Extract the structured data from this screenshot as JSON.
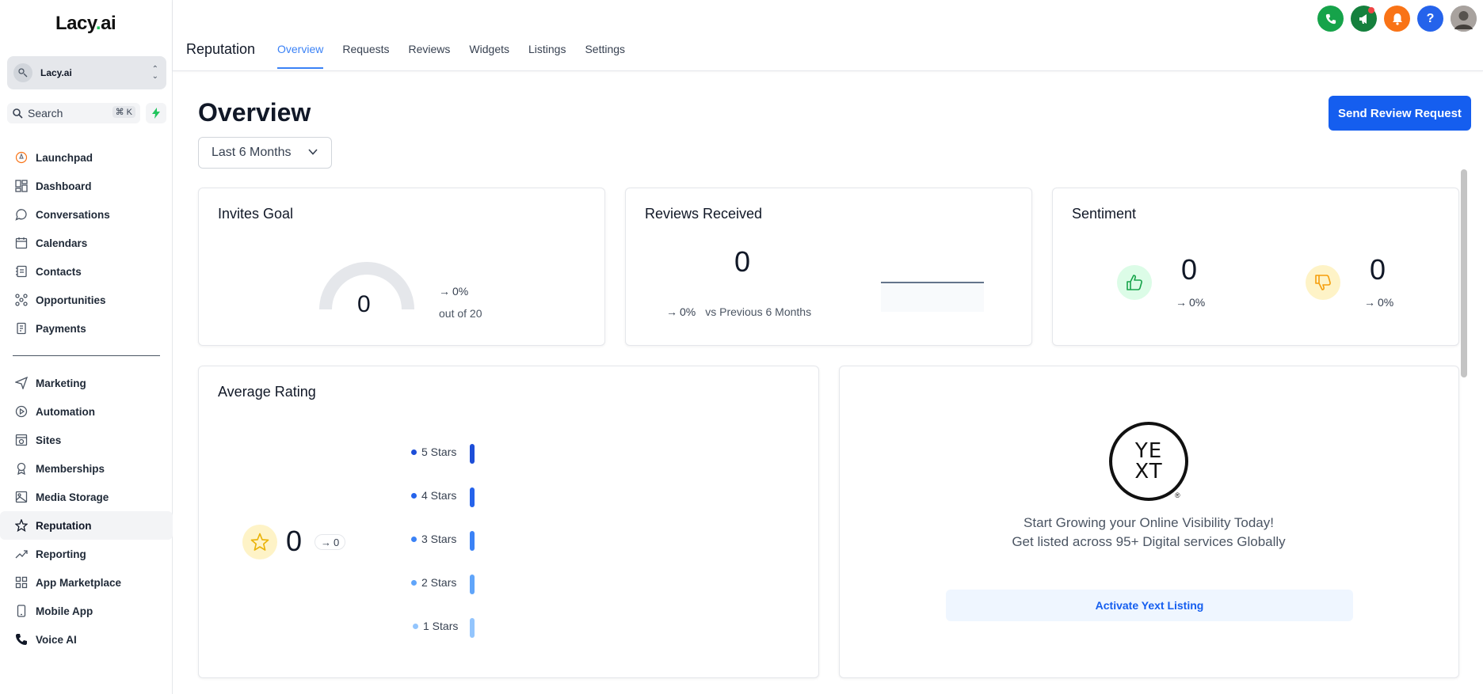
{
  "app": {
    "logo_main": "Lacy",
    "logo_dot": ".",
    "logo_tail": "ai"
  },
  "account": {
    "name": "Lacy.ai"
  },
  "search": {
    "placeholder": "Search",
    "shortcut": "⌘ K"
  },
  "sidebar": {
    "items": [
      {
        "label": "Launchpad",
        "icon": "rocket-icon"
      },
      {
        "label": "Dashboard",
        "icon": "grid-icon"
      },
      {
        "label": "Conversations",
        "icon": "chat-icon"
      },
      {
        "label": "Calendars",
        "icon": "calendar-icon"
      },
      {
        "label": "Contacts",
        "icon": "contacts-icon"
      },
      {
        "label": "Opportunities",
        "icon": "opportunities-icon"
      },
      {
        "label": "Payments",
        "icon": "payments-icon"
      }
    ],
    "items2": [
      {
        "label": "Marketing",
        "icon": "send-icon"
      },
      {
        "label": "Automation",
        "icon": "automation-icon"
      },
      {
        "label": "Sites",
        "icon": "sites-icon"
      },
      {
        "label": "Memberships",
        "icon": "award-icon"
      },
      {
        "label": "Media Storage",
        "icon": "image-icon"
      },
      {
        "label": "Reputation",
        "icon": "star-icon",
        "active": true
      },
      {
        "label": "Reporting",
        "icon": "trend-icon"
      },
      {
        "label": "App Marketplace",
        "icon": "apps-icon"
      },
      {
        "label": "Mobile App",
        "icon": "mobile-icon"
      },
      {
        "label": "Voice AI",
        "icon": "phone-icon"
      }
    ]
  },
  "header": {
    "section": "Reputation",
    "tabs": [
      "Overview",
      "Requests",
      "Reviews",
      "Widgets",
      "Listings",
      "Settings"
    ],
    "active_tab": "Overview",
    "icon_colors": {
      "phone": "#16a34a",
      "announce": "#15803d",
      "bell": "#f97316",
      "help": "#2563eb"
    }
  },
  "main": {
    "title": "Overview",
    "range": "Last 6 Months",
    "primary_button": "Send Review Request"
  },
  "invites": {
    "title": "Invites Goal",
    "value": "0",
    "change": "0%",
    "goal": "out of 20"
  },
  "reviews": {
    "title": "Reviews Received",
    "value": "0",
    "change": "0%",
    "compare": "vs Previous 6 Months"
  },
  "sentiment": {
    "title": "Sentiment",
    "positive": "0",
    "positive_change": "0%",
    "negative": "0",
    "negative_change": "0%"
  },
  "rating": {
    "title": "Average Rating",
    "value": "0",
    "delta": "0",
    "rows": [
      {
        "label": "5 Stars",
        "color": "#1d4ed8"
      },
      {
        "label": "4 Stars",
        "color": "#2563eb"
      },
      {
        "label": "3 Stars",
        "color": "#3b82f6"
      },
      {
        "label": "2 Stars",
        "color": "#60a5fa"
      },
      {
        "label": "1 Stars",
        "color": "#93c5fd"
      }
    ]
  },
  "yext": {
    "logo_top": "YE",
    "logo_bottom": "XT",
    "line1": "Start Growing your Online Visibility Today!",
    "line2": "Get listed across 95+ Digital services Globally",
    "button": "Activate Yext Listing"
  },
  "colors": {
    "accent": "#155eef",
    "tab_active": "#3b82f6",
    "positive": "#16a34a",
    "negative": "#f59e0b"
  }
}
